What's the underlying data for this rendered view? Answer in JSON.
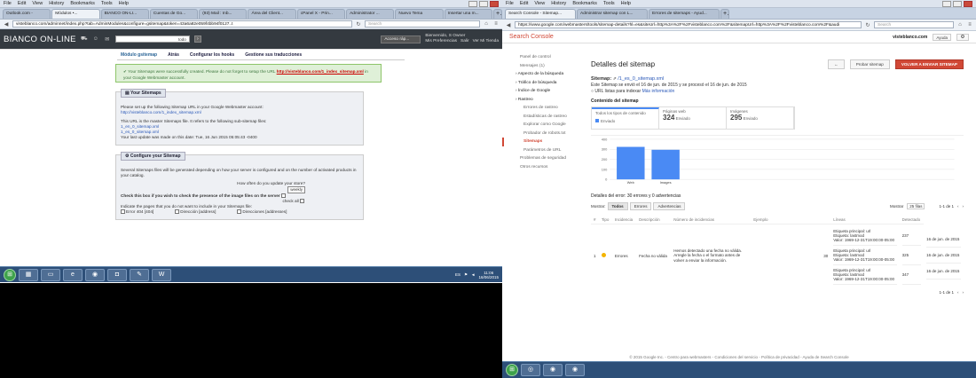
{
  "left": {
    "menu": [
      "File",
      "Edit",
      "View",
      "History",
      "Bookmarks",
      "Tools",
      "Help"
    ],
    "tabs": [
      "Outlook.com -",
      "Módulos •...",
      "BIANCO ON-LI...",
      "Cuentas de Go...",
      "(93) Mail : Inb...",
      "Área del Client...",
      "cPanel X - Prin...",
      "Administrator ...",
      "Nuevo Tema",
      "Insertar una m..."
    ],
    "url": "visteblanco.com/adminnet/index.php?tab=AdminModules&configure=gsitemap&token=43a6a82e059f4bb94f0127..t",
    "search_placeholder": "Search",
    "app": {
      "logo": "BIANCO ON-LINE",
      "search_value": "todo",
      "quick_access": "Acceso ráp...",
      "welcome": "Bienvenido, S Owner",
      "prefs": "Mis Preferencias",
      "logout": "Salir",
      "shop": "Ver Mi Tienda"
    },
    "toolbar": [
      "Catálogo",
      "Pedidos",
      "Clientes",
      "Reglas de precios",
      "Transporte",
      "Localización",
      "Módulos",
      "Preferencias",
      "Parámetros Avanzados",
      "Administración",
      "Estadísticas"
    ],
    "subnav": [
      "Módulo gsitemap",
      "Atrás",
      "Configurar los hooks",
      "Gestione sus traducciones"
    ],
    "notice_text": "Your Sitemaps were successfully created. Please do not forget to setup the URL",
    "notice_link": "http://visteblanco.com/1_index_sitemap.xml",
    "notice_tail": "in your Google Webmaster account.",
    "your_sitemaps": {
      "title": "Your Sitemaps",
      "line1": "Please set up the following Sitemap URL in your Google Webmaster account:",
      "url": "http://visteblanco.com/1_index_sitemap.xml",
      "line2": "This URL is the master Sitemaps file. It refers to the following sub-sitemap files:",
      "sub1": "1_en_0_sitemap.xml",
      "sub2": "1_es_0_sitemap.xml",
      "last": "Your last update was made on this date: Tue, 16 Jun 2015 05:05:43 -0400"
    },
    "configure": {
      "title": "Configure your Sitemap",
      "desc": "Several Sitemaps files will be generated depending on how your server is configured and on the number of activated products in your catalog.",
      "freq_label": "How often do you update your store?",
      "freq_value": "weekly",
      "check_label": "Check this box if you wish to check the presence of the image files on the server",
      "check_all": "check all",
      "indicate": "Indicate the pages that you do not want to include in your Sitemaps file:",
      "opt1": "Error 404 [404]",
      "opt2": "Dirección [address]",
      "opt3": "Direcciones [addresses]"
    },
    "clock_time": "11:06",
    "clock_date": "16/06/2015",
    "tray_lang": "ES"
  },
  "right": {
    "menu": [
      "File",
      "Edit",
      "View",
      "History",
      "Bookmarks",
      "Tools",
      "Help"
    ],
    "tabs": [
      "Search Console - Sitemap...",
      "Administrar sitemap con L...",
      "Errores de sitemaps - Ayud..."
    ],
    "url": "https://www.google.com/webmasters/tools/sitemap-details?hl=es&siteUrl=http%3A%2F%2Fvisteblanco.com%2F&sitemapUrl=http%3A%2F%2Fvisteblanco.com%2F&audi",
    "search_placeholder": "Search",
    "gsc": {
      "logo": "Search Console",
      "site": "visteblanco.com",
      "lang": "Ayuda"
    },
    "sidebar": [
      {
        "label": "Panel de control",
        "type": "top"
      },
      {
        "label": "Mensajes (1)",
        "type": "top"
      },
      {
        "label": "Aspecto de la búsqueda",
        "type": "grp"
      },
      {
        "label": "Tráfico de búsqueda",
        "type": "grp"
      },
      {
        "label": "Índice de Google",
        "type": "grp"
      },
      {
        "label": "Rastreo",
        "type": "grp"
      },
      {
        "label": "Errores de rastreo",
        "type": "sub"
      },
      {
        "label": "Estadísticas de rastreo",
        "type": "sub"
      },
      {
        "label": "Explorar como Google",
        "type": "sub"
      },
      {
        "label": "Probador de robots.txt",
        "type": "sub"
      },
      {
        "label": "Sitemaps",
        "type": "active"
      },
      {
        "label": "Parámetros de URL",
        "type": "sub"
      },
      {
        "label": "Problemas de seguridad",
        "type": "top"
      },
      {
        "label": "Otros recursos",
        "type": "top"
      }
    ],
    "page_title": "Detalles del sitemap",
    "btn_back": "←",
    "btn_test": "Probar sitemap",
    "btn_resubmit": "VOLVER A ENVIAR SITEMAP",
    "sitemap_label": "Sitemap:",
    "sitemap_path": "/1_es_0_sitemap.xml",
    "submitted": "Este Sitemap se envió el 16 de jun. de 2015 y se procesó el 16 de jun. de 2015",
    "url_index": "URL listas para indexar",
    "more_info": "Más información",
    "content_title": "Contenido del sitemap",
    "tiles": [
      {
        "label": "Todos los tipos de contenido",
        "sub": "Enviado",
        "num": ""
      },
      {
        "label": "Páginas web",
        "num": "324",
        "sub": "Enviado"
      },
      {
        "label": "Imágenes",
        "num": "295",
        "sub": "Enviado"
      }
    ],
    "chart_data": {
      "type": "bar",
      "categories": [
        "Web",
        "Images"
      ],
      "values": [
        324,
        295
      ],
      "ylim": [
        0,
        400
      ],
      "yticks": [
        "400",
        "300",
        "200",
        "100",
        "0"
      ],
      "colors": {
        "bar": "#4a8af4"
      }
    },
    "errors_title": "Detalles del error: 30 errores y 0 advertencias",
    "show_label": "Mostrar:",
    "filters": [
      "Todos",
      "Errores",
      "Advertencias"
    ],
    "rows_label": "Mostrar",
    "rows_value": "25 filas",
    "range": "1-1 de 1",
    "range_bottom": "1-1 de 1",
    "table_headers": [
      "#",
      "Tipo",
      "Incidencia",
      "Descripción",
      "Número de incidencias",
      "Ejemplo",
      "Líneas",
      "Detectado"
    ],
    "row": {
      "num": "1",
      "type": "Errores",
      "issue": "Fecha no válida",
      "desc": "Hemos detectado una fecha no válida. Arregle la fecha o el formato antes de volver a enviar la información.",
      "count": "30",
      "examples": [
        {
          "a": "Etiqueta principal: url",
          "b": "Etiqueta: lastmod",
          "c": "Valor: 1969-12-31T19:00:00-05:00",
          "line": "237",
          "date": "16 de jun. de 2015"
        },
        {
          "a": "Etiqueta principal: url",
          "b": "Etiqueta: lastmod",
          "c": "Valor: 1969-12-31T19:00:00-05:00",
          "line": "325",
          "date": "16 de jun. de 2015"
        },
        {
          "a": "Etiqueta principal: url",
          "b": "Etiqueta: lastmod",
          "c": "Valor: 1969-12-31T19:00:00-05:00",
          "line": "347",
          "date": "16 de jun. de 2015"
        }
      ]
    },
    "footer": "© 2015 Google Inc. - Centro para webmasters - Condiciones del servicio - Política de privacidad - Ayuda de Search Console"
  }
}
